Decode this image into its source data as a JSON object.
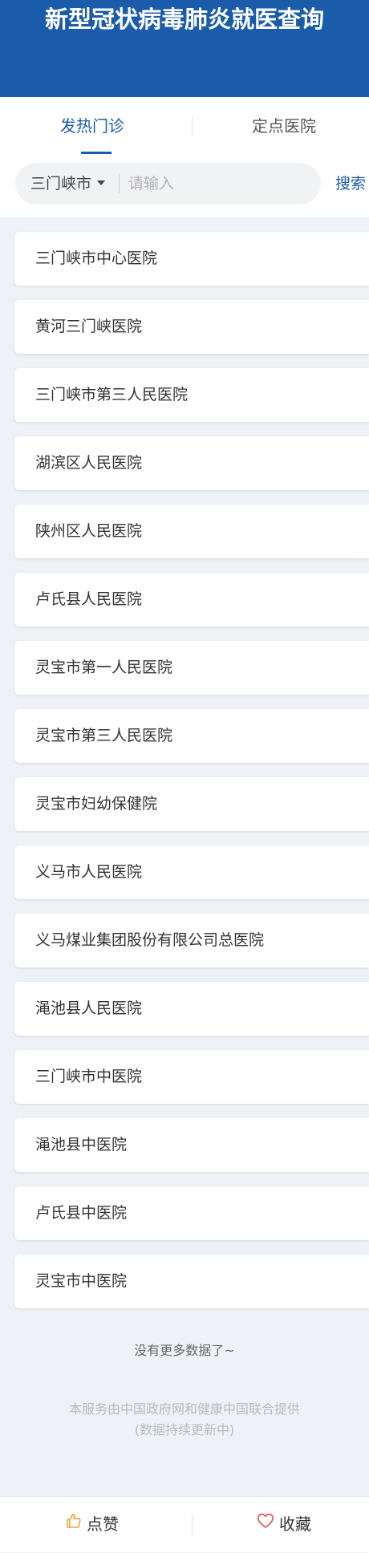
{
  "header": {
    "title": "新型冠状病毒肺炎就医查询"
  },
  "tabs": [
    {
      "label": "发热门诊",
      "active": true
    },
    {
      "label": "定点医院",
      "active": false
    }
  ],
  "search": {
    "city": "三门峡市",
    "placeholder": "请输入",
    "value": "",
    "button_label": "搜索"
  },
  "hospitals": [
    "三门峡市中心医院",
    "黄河三门峡医院",
    "三门峡市第三人民医院",
    "湖滨区人民医院",
    "陕州区人民医院",
    "卢氏县人民医院",
    "灵宝市第一人民医院",
    "灵宝市第三人民医院",
    "灵宝市妇幼保健院",
    "义马市人民医院",
    "义马煤业集团股份有限公司总医院",
    "渑池县人民医院",
    "三门峡市中医院",
    "渑池县中医院",
    "卢氏县中医院",
    "灵宝市中医院"
  ],
  "footer": {
    "no_more": "没有更多数据了~",
    "credit_line1": "本服务由中国政府网和健康中国联合提供",
    "credit_line2": "(数据持续更新中)"
  },
  "bottom_bar": {
    "like_label": "点赞",
    "like_icon": "thumbs-up-icon",
    "favorite_label": "收藏",
    "favorite_icon": "heart-icon"
  },
  "colors": {
    "brand_blue": "#1a5caa",
    "page_background": "#eef2f6",
    "icon_orange": "#f0a030",
    "icon_red": "#e05555"
  }
}
